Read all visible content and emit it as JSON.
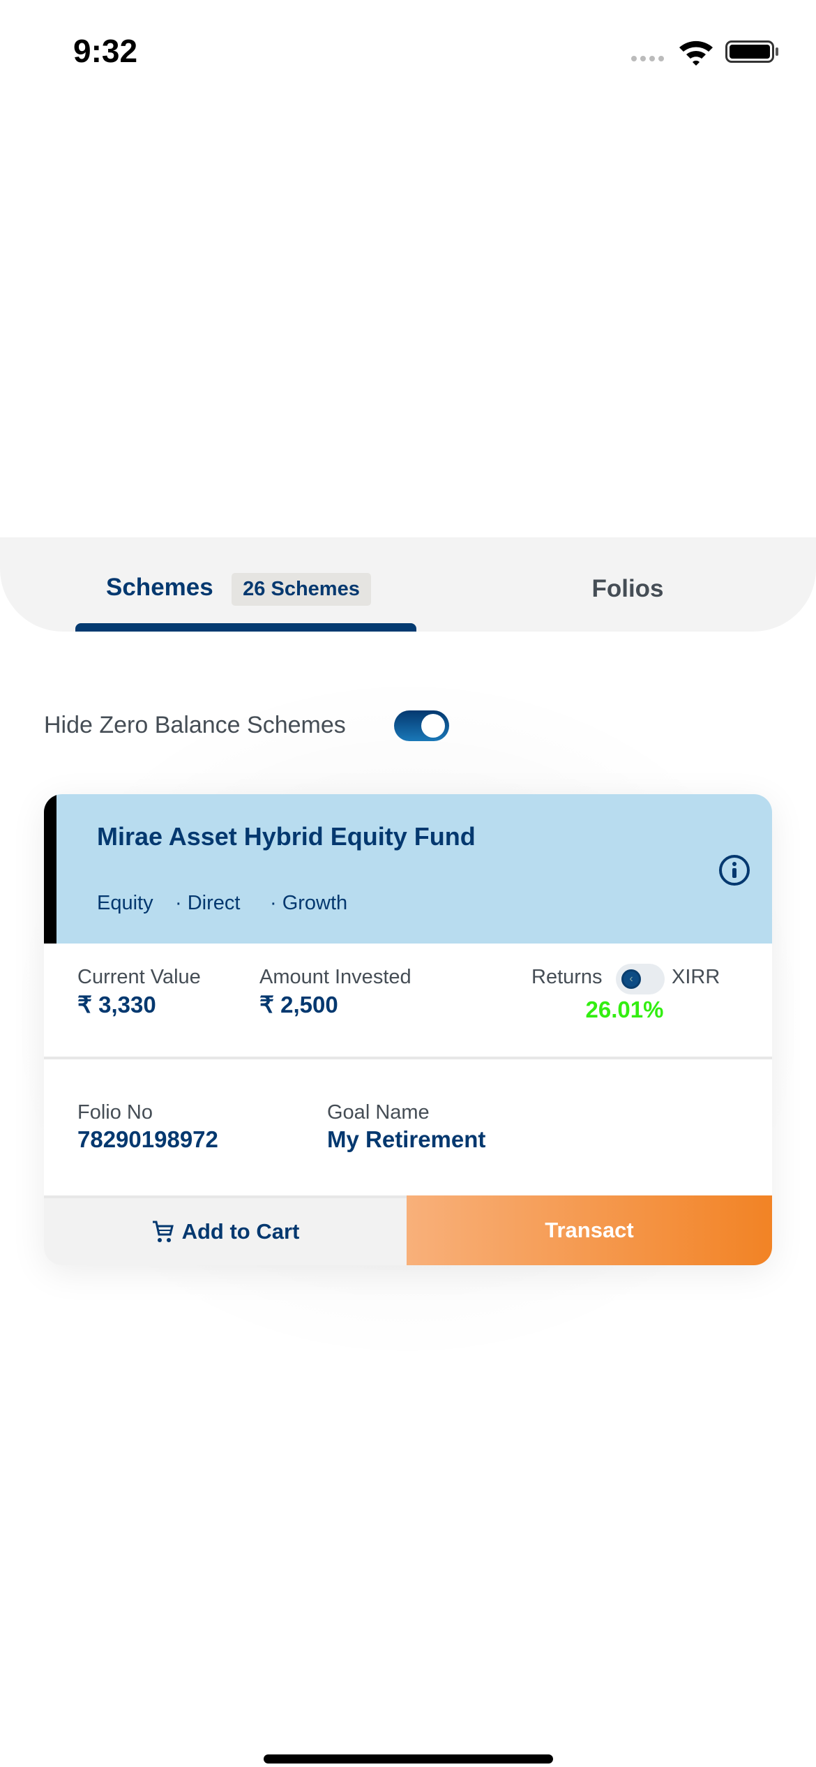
{
  "status_bar": {
    "time": "9:32"
  },
  "tabs": [
    {
      "label": "Schemes",
      "badge": "26 Schemes",
      "active": true
    },
    {
      "label": "Folios",
      "active": false
    }
  ],
  "filter": {
    "label": "Hide Zero Balance Schemes",
    "enabled": true
  },
  "scheme_card": {
    "name": "Mirae Asset Hybrid Equity Fund",
    "category": "Equity",
    "plan": "· Direct",
    "option": "· Growth",
    "current_value_label": "Current Value",
    "current_value": "₹ 3,330",
    "amount_invested_label": "Amount Invested",
    "amount_invested": "₹ 2,500",
    "returns_label": "Returns",
    "xirr_label": "XIRR",
    "returns_value": "26.01%",
    "folio_label": "Folio No",
    "folio_value": "78290198972",
    "goal_label": "Goal Name",
    "goal_value": "My Retirement",
    "add_to_cart": "Add to Cart",
    "transact": "Transact"
  },
  "colors": {
    "primary": "#04386f",
    "accent": "#f28325",
    "positive": "#33ee11",
    "card_header": "#b8dcef"
  }
}
